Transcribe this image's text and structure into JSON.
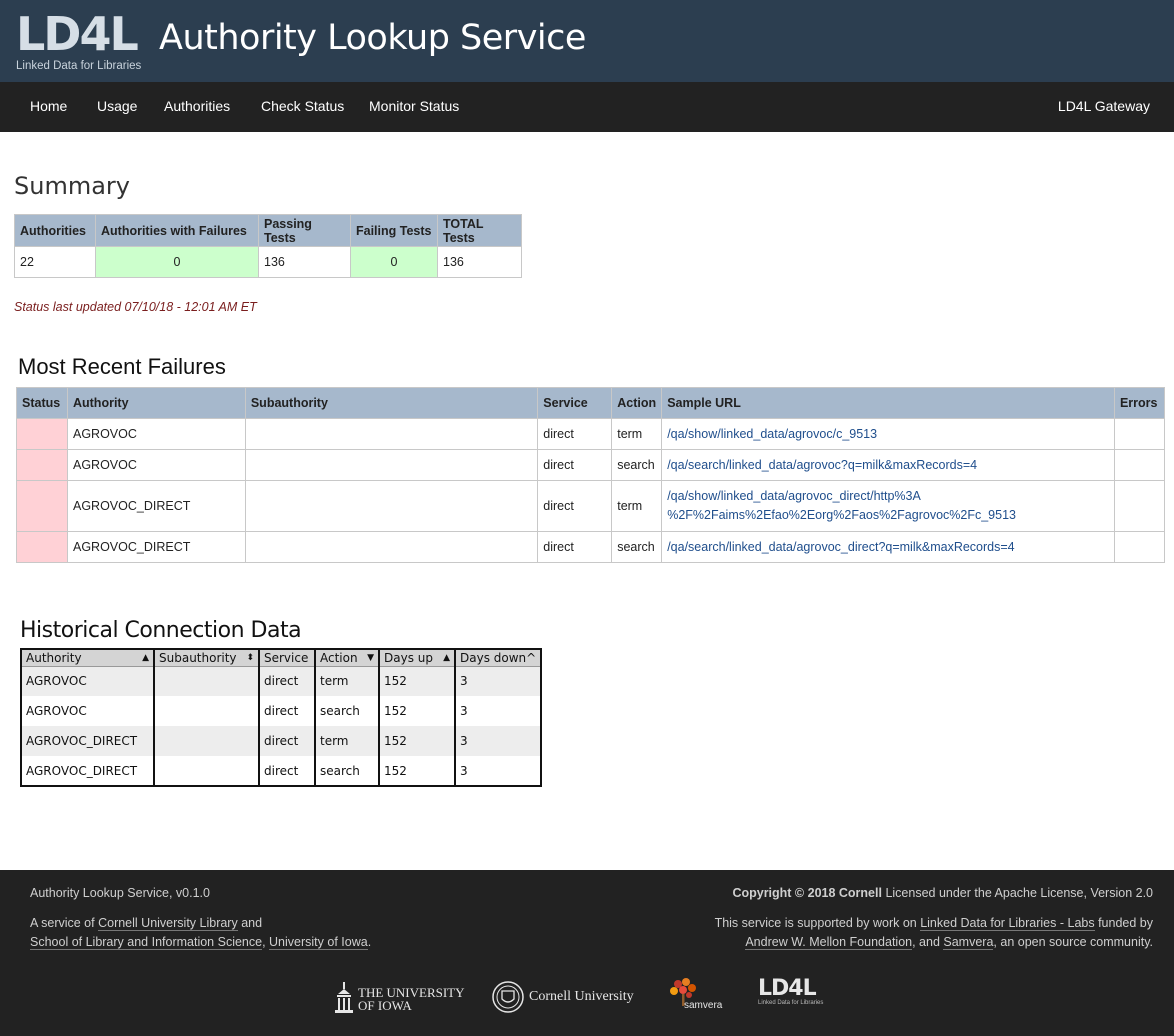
{
  "header": {
    "logo_text": "LD4L",
    "logo_sub": "Linked Data for Libraries",
    "title": "Authority Lookup Service"
  },
  "nav": {
    "items": [
      "Home",
      "Usage",
      "Authorities",
      "Check Status",
      "Monitor Status"
    ],
    "right": "LD4L Gateway"
  },
  "summary": {
    "title": "Summary",
    "headers": [
      "Authorities",
      "Authorities with Failures",
      "Passing Tests",
      "Failing Tests",
      "TOTAL Tests"
    ],
    "values": [
      "22",
      "0",
      "136",
      "0",
      "136"
    ],
    "colors": {
      "ok_cell": "#ccffcc",
      "header_bg": "#a6b8cc"
    }
  },
  "status_updated": "Status last updated 07/10/18 - 12:01 AM ET",
  "failures": {
    "title": "Most Recent Failures",
    "headers": [
      "Status",
      "Authority",
      "Subauthority",
      "Service",
      "Action",
      "Sample URL",
      "Errors"
    ],
    "status_color": "#ffd1d6",
    "rows": [
      {
        "authority": "AGROVOC",
        "subauthority": "",
        "service": "direct",
        "action": "term",
        "url": "/qa/show/linked_data/agrovoc/c_9513",
        "url_line2": "",
        "errors": ""
      },
      {
        "authority": "AGROVOC",
        "subauthority": "",
        "service": "direct",
        "action": "search",
        "url": "/qa/search/linked_data/agrovoc?q=milk&maxRecords=4",
        "url_line2": "",
        "errors": ""
      },
      {
        "authority": "AGROVOC_DIRECT",
        "subauthority": "",
        "service": "direct",
        "action": "term",
        "url": "/qa/show/linked_data/agrovoc_direct/http%3A",
        "url_line2": "%2F%2Faims%2Efao%2Eorg%2Faos%2Fagrovoc%2Fc_9513",
        "errors": ""
      },
      {
        "authority": "AGROVOC_DIRECT",
        "subauthority": "",
        "service": "direct",
        "action": "search",
        "url": "/qa/search/linked_data/agrovoc_direct?q=milk&maxRecords=4",
        "url_line2": "",
        "errors": ""
      }
    ]
  },
  "historical": {
    "title": "Historical Connection Data",
    "headers": [
      "Authority",
      "Subauthority",
      "Service",
      "Action",
      "Days up",
      "Days down^"
    ],
    "sort_icons": [
      "sort-asc-icon",
      "sort-both-icon",
      "",
      "sort-desc-icon",
      "sort-asc-icon",
      ""
    ],
    "rows": [
      [
        "AGROVOC",
        "",
        "direct",
        "term",
        "152",
        "3"
      ],
      [
        "AGROVOC",
        "",
        "direct",
        "search",
        "152",
        "3"
      ],
      [
        "AGROVOC_DIRECT",
        "",
        "direct",
        "term",
        "152",
        "3"
      ],
      [
        "AGROVOC_DIRECT",
        "",
        "direct",
        "search",
        "152",
        "3"
      ]
    ]
  },
  "footer": {
    "version": "Authority Lookup Service, v0.1.0",
    "service_prefix": "A service of ",
    "cornell_link": "Cornell University Library",
    "and": " and",
    "iowa_link": "School of Library and Information Science",
    "comma": ", ",
    "iowa_univ_link": "University of Iowa",
    "period": ".",
    "copyright": "Copyright © 2018 Cornell",
    "license": " Licensed under the Apache License, Version 2.0",
    "support_prefix": "This service is supported by work on ",
    "ld4l_labs_link": "Linked Data for Libraries - Labs",
    "funded_by": " funded by",
    "mellon_link": "Andrew W. Mellon Foundation",
    "and_comma": ", and ",
    "samvera_link": "Samvera",
    "support_suffix": ", an open source community.",
    "logos": {
      "iowa_line1": "THE UNIVERSITY",
      "iowa_line2": "OF IOWA",
      "cornell": "Cornell University",
      "samvera": "samvera",
      "ld4l": "LD4L",
      "ld4l_sub": "Linked Data for Libraries"
    }
  }
}
